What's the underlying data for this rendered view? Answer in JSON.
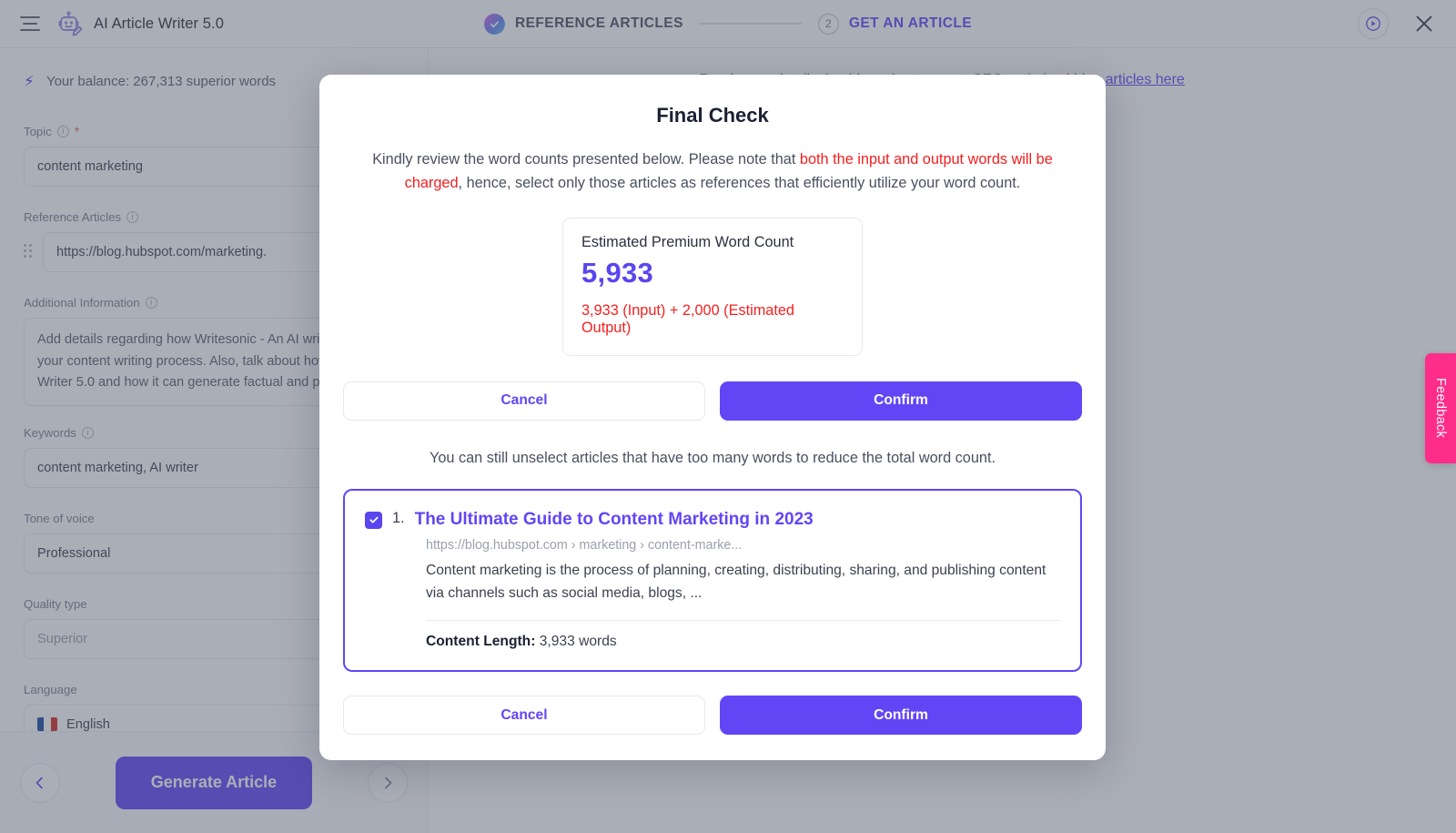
{
  "topbar": {
    "menu_icon": "hamburger-menu-icon",
    "logo_icon": "robot-pencil-logo-icon",
    "brand_name": "AI Article Writer 5.0",
    "play_icon": "play-circle-icon",
    "close_icon": "close-x-icon",
    "steps": [
      {
        "label": "REFERENCE ARTICLES",
        "state": "done",
        "marker": "check-icon"
      },
      {
        "label": "GET AN ARTICLE",
        "state": "active",
        "marker": "2"
      }
    ]
  },
  "form": {
    "balance_icon": "bolt-icon",
    "balance_text": "Your balance: 267,313 superior words",
    "topic": {
      "label": "Topic",
      "required_marker": "*",
      "info_icon": "info-icon",
      "value": "content marketing"
    },
    "reference_articles": {
      "label": "Reference Articles",
      "info_icon": "info-icon",
      "drag_icon": "drag-handle-icon",
      "value": "https://blog.hubspot.com/marketing."
    },
    "additional_information": {
      "label": "Additional Information",
      "info_icon": "info-icon",
      "value": "Add details regarding how Writesonic - An AI writing tool can help you automate your content writing process. Also, talk about how our newly launched AI Article Writer 5.0 and how it can generate factual and personalised content in seconds."
    },
    "keywords": {
      "label": "Keywords",
      "info_icon": "info-icon",
      "value": "content marketing, AI writer"
    },
    "tone_of_voice": {
      "label": "Tone of voice",
      "value": "Professional"
    },
    "quality_type": {
      "label": "Quality type",
      "value": "Superior"
    },
    "language": {
      "label": "Language",
      "value": "English",
      "flag_icon": "us-flag-icon"
    }
  },
  "right_panel": {
    "hint_prefix": "Read more details, besides, about correct SEO optimised blog ",
    "hint_link": "articles here"
  },
  "bottombar": {
    "back_icon": "arrow-left-icon",
    "next_icon": "arrow-right-icon",
    "generate_label": "Generate Article"
  },
  "feedback_tab": {
    "label": "Feedback"
  },
  "modal": {
    "title": "Final Check",
    "desc_part1": "Kindly review the word counts presented below. Please note that ",
    "desc_warn": "both the input and output words will be charged",
    "desc_part2": ", hence, select only those articles as references that efficiently utilize your word count.",
    "count_card": {
      "label": "Estimated Premium Word Count",
      "value": "5,933",
      "breakdown": "3,933 (Input) + 2,000 (Estimated Output)"
    },
    "buttons_top": {
      "cancel": "Cancel",
      "confirm": "Confirm"
    },
    "unselect_hint": "You can still unselect articles that have too many words to reduce the total word count.",
    "articles": [
      {
        "index": "1.",
        "checked": true,
        "check_icon": "checkmark-icon",
        "title": "The Ultimate Guide to Content Marketing in 2023",
        "url": "https://blog.hubspot.com › marketing › content-marke...",
        "snippet": "Content marketing is the process of planning, creating, distributing, sharing, and publishing content via channels such as social media, blogs, ...",
        "length_label": "Content Length:",
        "length_value": "3,933 words"
      }
    ],
    "buttons_bottom": {
      "cancel": "Cancel",
      "confirm": "Confirm"
    }
  },
  "colors": {
    "accent_purple": "#6246f5",
    "warn_red": "#f41f1f",
    "feedback_pink": "#ff2d8a",
    "value_purple": "#5a46ef"
  }
}
